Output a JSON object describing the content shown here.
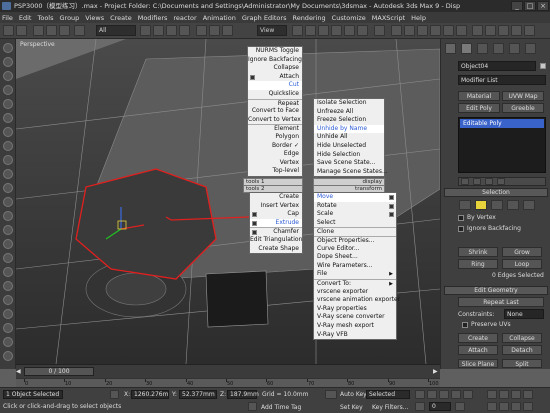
{
  "title_bar": {
    "text": "PSP3000（模型练习）.max   - Project Folder: C:\\Documents and Settings\\Administrator\\My Documents\\3dsmax   - Autodesk 3ds Max 9   - Disp"
  },
  "menu_bar": [
    "File",
    "Edit",
    "Tools",
    "Group",
    "Views",
    "Create",
    "Modifiers",
    "reactor",
    "Animation",
    "Graph Editors",
    "Rendering",
    "Customize",
    "MAXScript",
    "Help"
  ],
  "toolbar": {
    "selection_filter": "All",
    "reference_coord": "View"
  },
  "viewport": {
    "label": "Perspective"
  },
  "quad_menu": {
    "upper_left": [
      {
        "label": "NURMS Toggle"
      },
      {
        "label": "Ignore Backfacing"
      },
      {
        "label": "Collapse"
      },
      {
        "label": "Attach",
        "icon": true
      },
      {
        "label": "Cut",
        "highlight": true
      },
      {
        "label": "Quickslice"
      },
      {
        "label": "Repeat",
        "sep": true
      },
      {
        "label": "Convert to Face"
      },
      {
        "label": "Convert to Vertex"
      },
      {
        "label": "Element",
        "sep": true
      },
      {
        "label": "Polygon"
      },
      {
        "label": "Border ✓"
      },
      {
        "label": "Edge"
      },
      {
        "label": "Vertex"
      },
      {
        "label": "Top-level"
      }
    ],
    "upper_right": [
      {
        "label": "Isolate Selection"
      },
      {
        "label": "Unfreeze All"
      },
      {
        "label": "Freeze Selection"
      },
      {
        "label": "Unhide by Name",
        "highlight": true
      },
      {
        "label": "Unhide All"
      },
      {
        "label": "Hide Unselected"
      },
      {
        "label": "Hide Selection"
      },
      {
        "label": "Save Scene State..."
      },
      {
        "label": "Manage Scene States..."
      }
    ],
    "headers": {
      "tools1": "tools 1",
      "display": "display",
      "tools2": "tools 2",
      "transform": "transform"
    },
    "lower_left": [
      {
        "label": "Create"
      },
      {
        "label": "Insert Vertex"
      },
      {
        "label": "Cap",
        "icon": true
      },
      {
        "label": "Extrude",
        "icon": true,
        "highlight": true
      },
      {
        "label": "Chamfer",
        "icon": true
      },
      {
        "label": "Edit Triangulation"
      },
      {
        "label": "Create Shape"
      }
    ],
    "lower_right": [
      {
        "label": "Move",
        "icon": true,
        "highlight": true
      },
      {
        "label": "Rotate",
        "icon": true
      },
      {
        "label": "Scale",
        "icon": true
      },
      {
        "label": "Select"
      },
      {
        "label": "Clone"
      },
      {
        "label": "Object Properties..."
      },
      {
        "label": "Curve Editor..."
      },
      {
        "label": "Dope Sheet..."
      },
      {
        "label": "Wire Parameters..."
      },
      {
        "label": "File",
        "arrow": true
      },
      {
        "label": "Convert To:",
        "arrow": true,
        "sep": true
      },
      {
        "label": "vrscene exporter"
      },
      {
        "label": "vrscene animation exporter"
      },
      {
        "label": "V-Ray properties"
      },
      {
        "label": "V-Ray scene converter"
      },
      {
        "label": "V-Ray mesh export"
      },
      {
        "label": "V-Ray VFB"
      }
    ]
  },
  "command_panel": {
    "object_name": "Object04",
    "modifier_list": "Modifier List",
    "buttons": {
      "material": "Material",
      "uvw_map": "UVW Map",
      "edit_poly": "Edit Poly",
      "greeble": "Greeble"
    },
    "stack_item": "Editable Poly",
    "selection": {
      "title": "Selection",
      "by_vertex": "By Vertex",
      "ignore_backfacing": "Ignore Backfacing",
      "shrink": "Shrink",
      "grow": "Grow",
      "ring": "Ring",
      "loop": "Loop",
      "status": "0 Edges Selected"
    },
    "edit_geometry": {
      "title": "Edit Geometry",
      "repeat_last": "Repeat Last",
      "constraints_label": "Constraints:",
      "constraints_value": "None",
      "preserve_uvs": "Preserve UVs",
      "create": "Create",
      "collapse": "Collapse",
      "attach": "Attach",
      "detach": "Detach",
      "slice_plane": "Slice Plane",
      "split": "Split"
    }
  },
  "timeline": {
    "frame": "0 / 100",
    "ticks": [
      "0",
      "10",
      "20",
      "30",
      "40",
      "50",
      "60",
      "70",
      "80",
      "90",
      "100"
    ]
  },
  "status_bar": {
    "selection": "1 Object Selected",
    "prompt": "Click or click-and-drag to select objects",
    "x": "1260.276m",
    "y": "52.377mm",
    "z": "187.9mm",
    "grid": "Grid = 10.0mm",
    "add_time_tag": "Add Time Tag",
    "auto_key": "Auto Key",
    "auto_key_value": "Selected",
    "set_key": "Set Key",
    "key_filters": "Key Filters...",
    "frame_field": "0"
  },
  "colors": {
    "menu_bg": "#efefef",
    "highlight_text": "#2c5bd6",
    "selected_stack": "#3a63c9",
    "poly_edge": "#e0201e"
  }
}
